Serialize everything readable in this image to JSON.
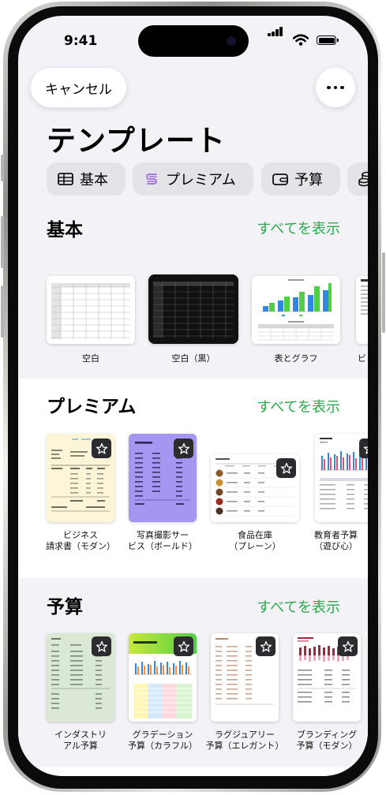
{
  "status_bar": {
    "time": "9:41"
  },
  "header": {
    "cancel_label": "キャンセル",
    "more_icon": "ellipsis-icon",
    "title": "テンプレート"
  },
  "categories": [
    {
      "label": "基本",
      "icon": "table-icon"
    },
    {
      "label": "プレミアム",
      "icon": "premium-icon"
    },
    {
      "label": "予算",
      "icon": "wallet-icon"
    },
    {
      "label": "",
      "icon": "coins-icon"
    }
  ],
  "sections": {
    "basic": {
      "title": "基本",
      "see_all": "すべてを表示",
      "items": [
        {
          "label": "空白"
        },
        {
          "label": "空白（黒）"
        },
        {
          "label": "表とグラフ"
        },
        {
          "label": "ビ"
        }
      ]
    },
    "premium": {
      "title": "プレミアム",
      "see_all": "すべてを表示",
      "items": [
        {
          "label": "ビジネス\n請求書（モダン）"
        },
        {
          "label": "写真撮影サー\nビス（ボールド）"
        },
        {
          "label": "食品在庫\n（プレーン）"
        },
        {
          "label": "教育者予算\n（遊び心）"
        }
      ]
    },
    "budget": {
      "title": "予算",
      "see_all": "すべてを表示",
      "items": [
        {
          "label": "インダストリ\nアル予算"
        },
        {
          "label": "グラデーション\n予算（カラフル）"
        },
        {
          "label": "ラグジュアリー\n予算（エレガント）"
        },
        {
          "label": "ブランディング\n予算（モダン）"
        }
      ]
    }
  },
  "colors": {
    "accent_green": "#2aa84a",
    "premium_purple": "#a596f2",
    "badge": "#2b2b30"
  }
}
